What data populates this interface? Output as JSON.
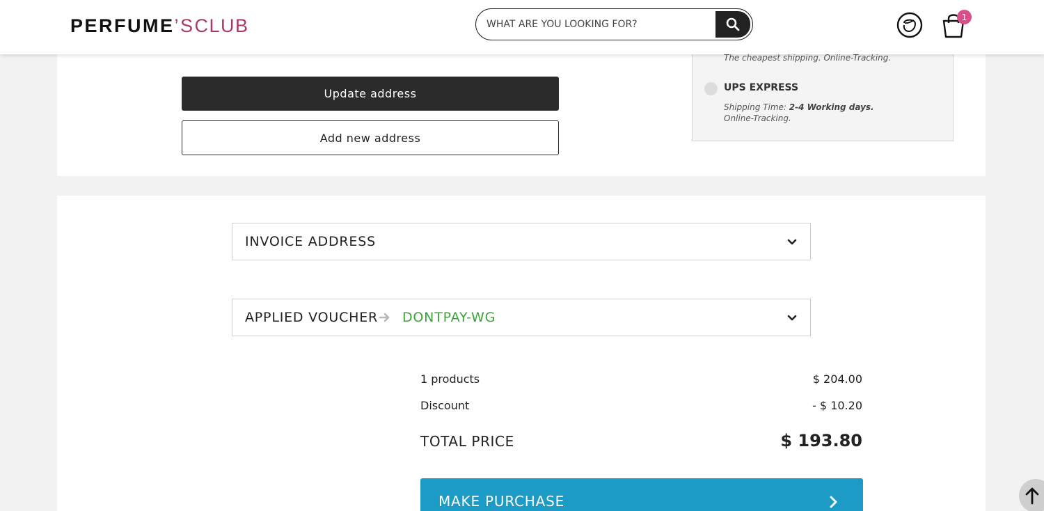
{
  "header": {
    "logo_part1": "PERFUME",
    "logo_part2": "’S",
    "logo_part3": "CLUB",
    "search_placeholder": "WHAT ARE YOU LOOKING FOR?",
    "cart_count": "1"
  },
  "address": {
    "update_label": "Update address",
    "add_label": "Add new address"
  },
  "shipping": {
    "standard_note": "The cheapest shipping. Online-Tracking.",
    "express_label": "UPS EXPRESS",
    "express_time_prefix": "Shipping Time: ",
    "express_time_value": "2-4 Working days.",
    "express_tracking": "Online-Tracking."
  },
  "invoice": {
    "title": "INVOICE ADDRESS"
  },
  "voucher": {
    "title": "APPLIED VOUCHER",
    "code": "DONTPAY-WG"
  },
  "summary": {
    "products_label": "1 products",
    "products_value": "$ 204.00",
    "discount_label": "Discount",
    "discount_value": "- $ 10.20",
    "total_label": "TOTAL PRICE",
    "total_value": "$ 193.80"
  },
  "purchase": {
    "label": "MAKE PURCHASE"
  },
  "colors": {
    "accent_blue": "#1b9bc6",
    "brand_pink": "#a8396a",
    "voucher_green": "#3aa63a",
    "badge_pink": "#d94f8a"
  }
}
